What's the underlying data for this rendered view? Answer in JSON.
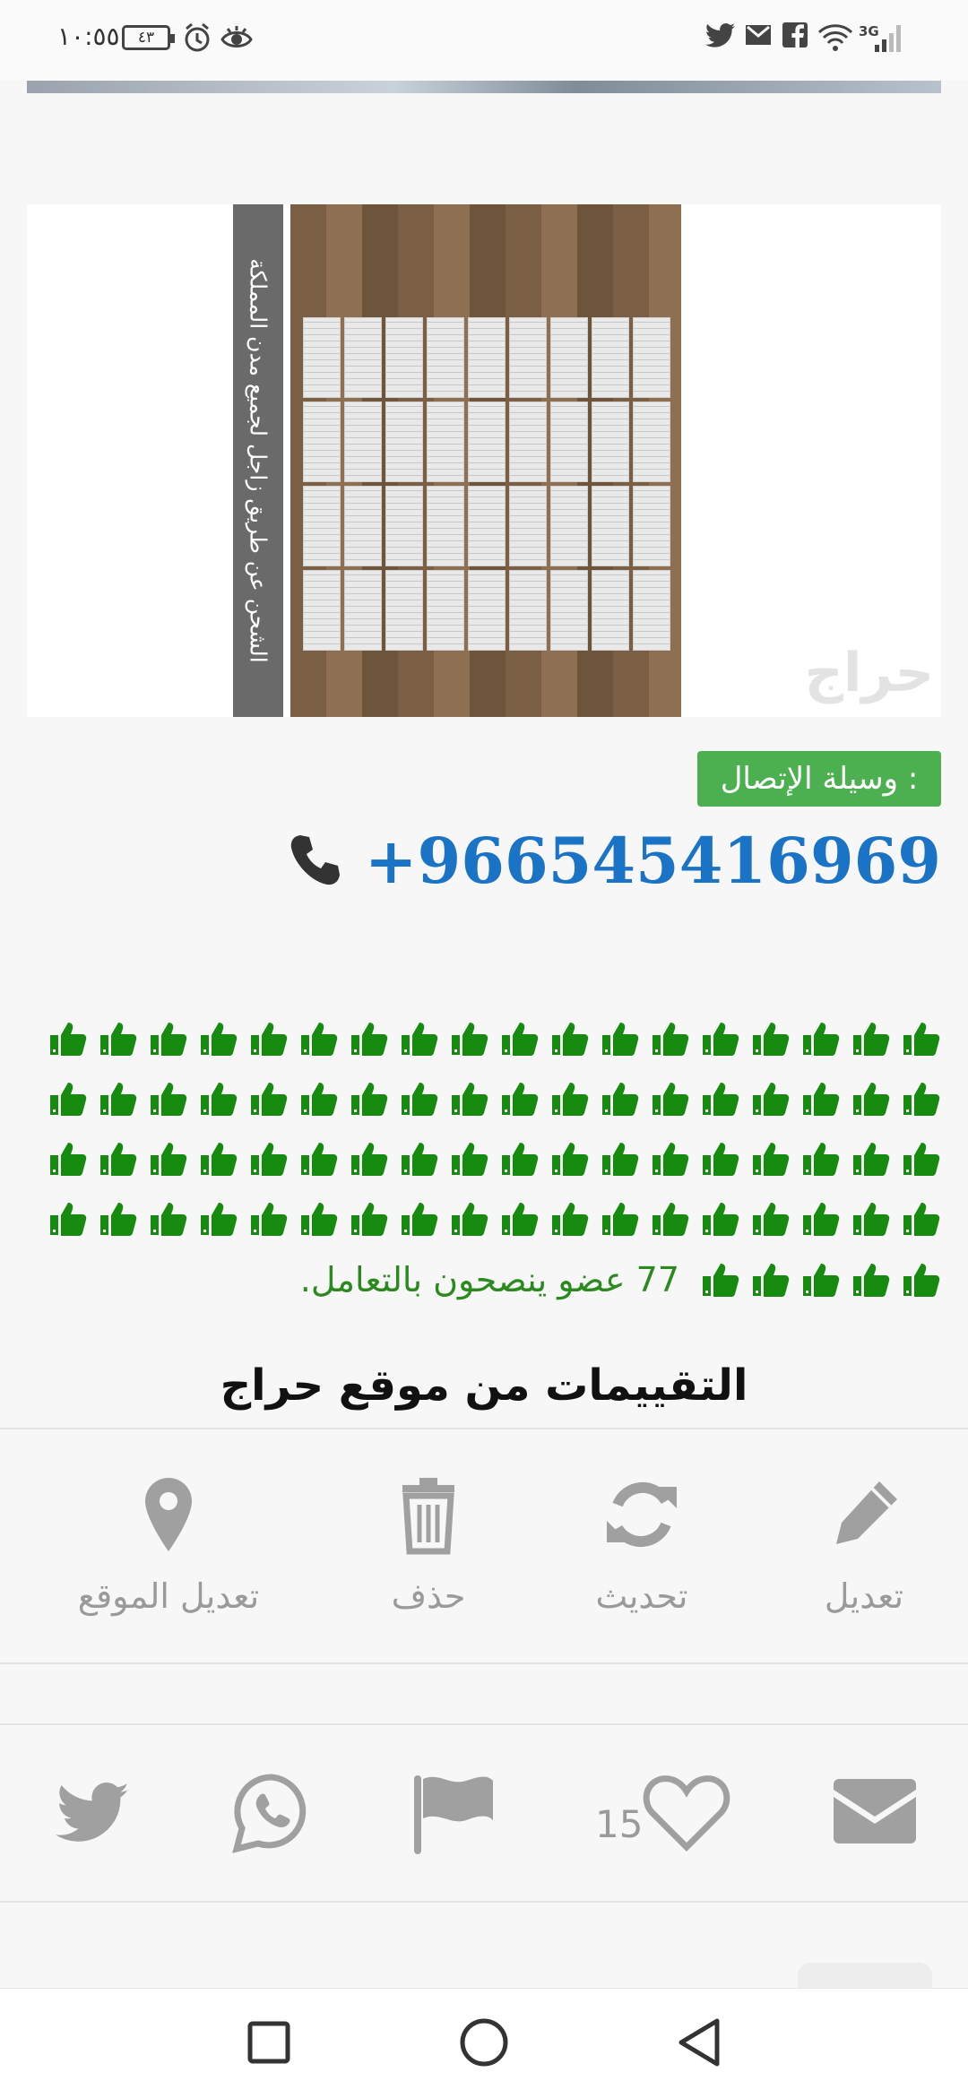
{
  "status_bar": {
    "time": "١٠:٥٥",
    "battery": "٤٣",
    "network": "3G"
  },
  "ad_image": {
    "caption": "الشحن عن طريق زاجل لجميع مدن المملكة",
    "watermark": "حراج"
  },
  "contact": {
    "label": "وسيلة الإتصال :",
    "phone": "+966545416969"
  },
  "recommendations": {
    "text": "77 عضو ينصحون بالتعامل."
  },
  "ratings": {
    "title": "التقييمات من موقع حراج"
  },
  "actions": {
    "edit": "تعديل",
    "refresh": "تحديث",
    "delete": "حذف",
    "edit_location": "تعديل الموقع"
  },
  "share": {
    "likes": "15"
  },
  "colors": {
    "accent_green": "#4caf50",
    "phone_blue": "#1a73c4",
    "thumb_green": "#178a10",
    "icon_gray": "#9a9a9a"
  }
}
